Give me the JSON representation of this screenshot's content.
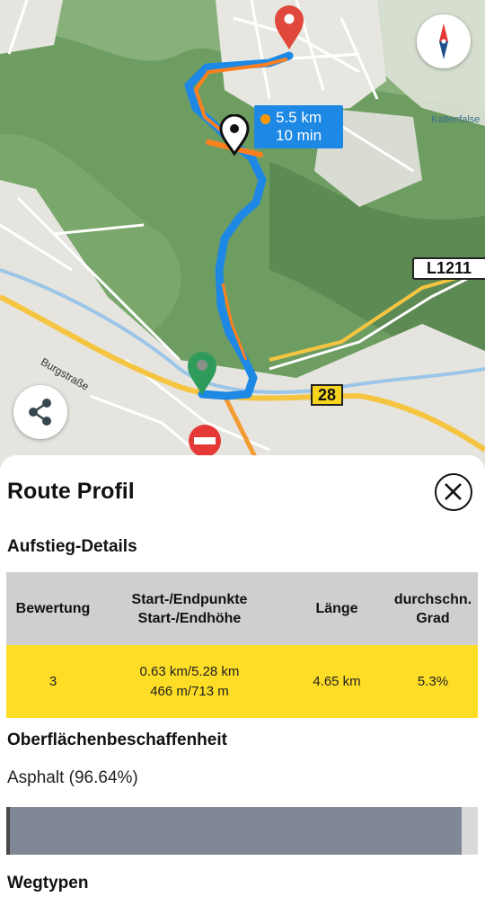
{
  "map": {
    "route_distance": "5.5 km",
    "route_time": "10 min",
    "road_sign_l": "L1211",
    "road_sign_b": "28",
    "street_label": "Burgstraße",
    "place_label": "Kaltenfalse"
  },
  "sheet": {
    "title": "Route Profil",
    "climb_heading": "Aufstieg-Details",
    "table": {
      "headers": {
        "rating": "Bewertung",
        "points_line1": "Start-/Endpunkte",
        "points_line2": "Start-/Endhöhe",
        "length": "Länge",
        "grade_line1": "durchschn.",
        "grade_line2": "Grad"
      },
      "row": {
        "rating": "3",
        "points_line1": "0.63 km/5.28 km",
        "points_line2": "466 m/713 m",
        "length": "4.65 km",
        "grade": "5.3%"
      }
    },
    "surface_heading": "Oberflächenbeschaffenheit",
    "surface_label": "Asphalt (96.64%)",
    "surface_fraction": 0.9664,
    "waytypes_heading": "Wegtypen"
  },
  "colors": {
    "route_blue": "#1e88e5",
    "route_orange": "#ff7f1e",
    "table_highlight": "#fddd26",
    "table_header": "#cfcfcf",
    "surface_bar": "#7f8894"
  }
}
